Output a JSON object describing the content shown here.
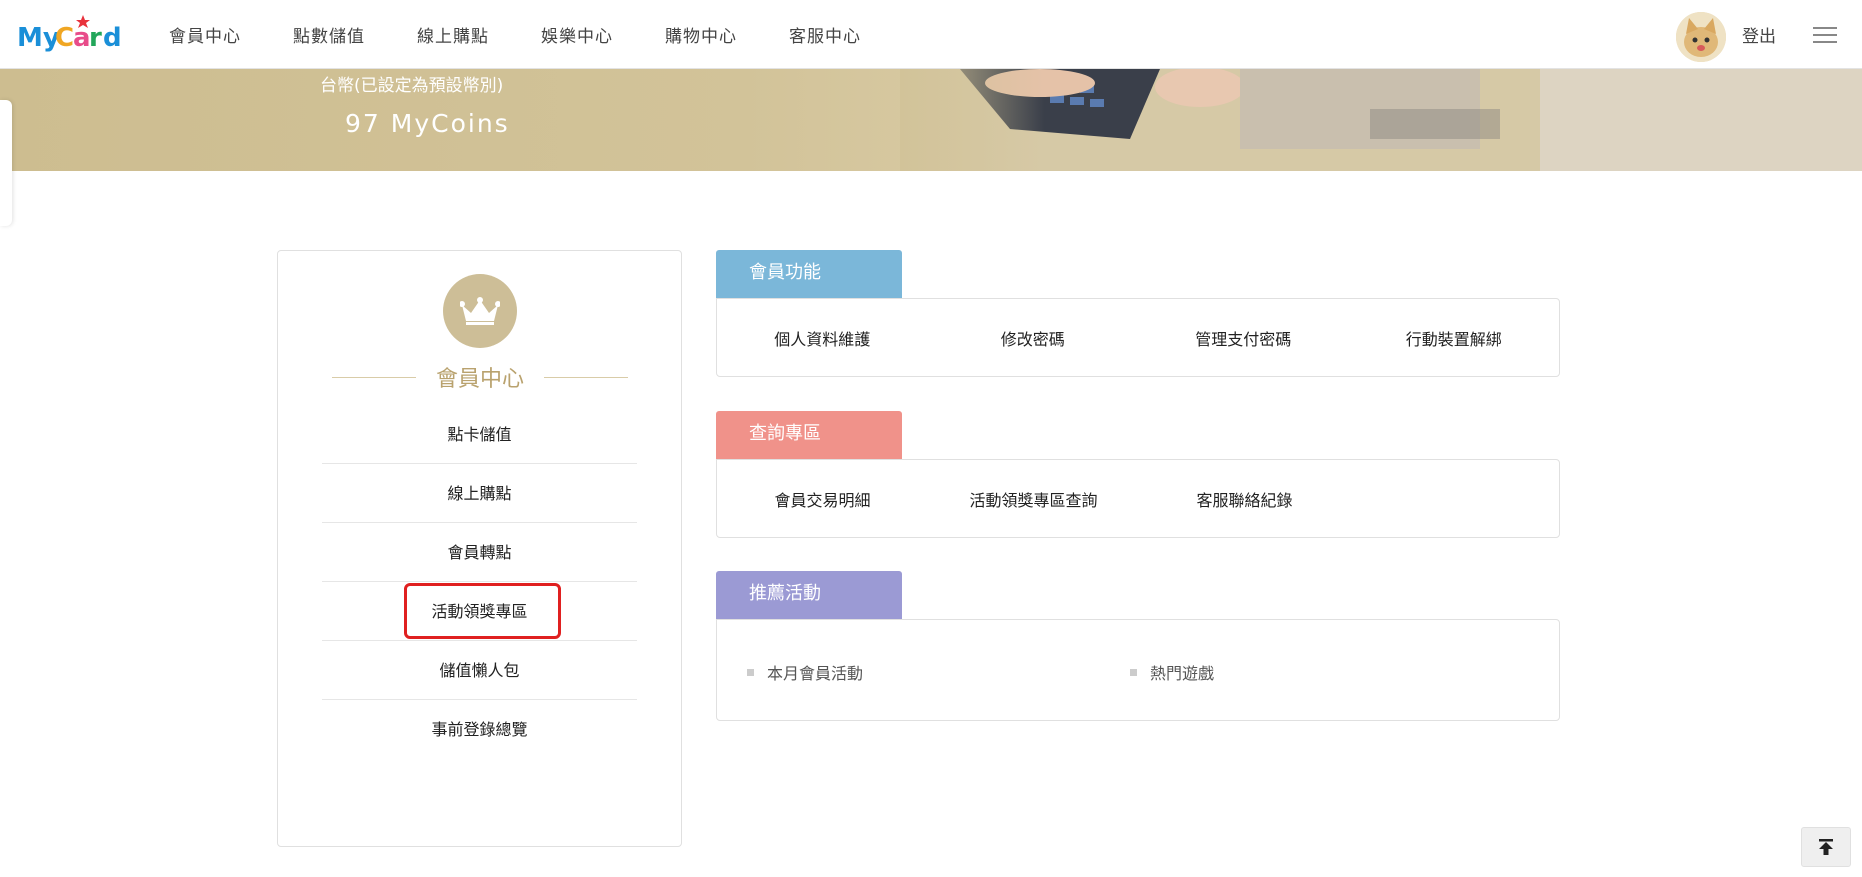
{
  "header": {
    "logo_text": "MyCard",
    "nav": [
      "會員中心",
      "點數儲值",
      "線上購點",
      "娛樂中心",
      "購物中心",
      "客服中心"
    ],
    "logout_label": "登出"
  },
  "banner": {
    "currency_label": "台幣(已設定為預設幣別)",
    "coin_amount": "97 MyCoins"
  },
  "member_panel": {
    "title": "會員中心",
    "menu": [
      "點卡儲值",
      "線上購點",
      "會員轉點",
      "活動領獎專區",
      "儲值懶人包",
      "事前登錄總覽"
    ],
    "highlighted_item": "活動領獎專區"
  },
  "sections": {
    "member_functions": {
      "title": "會員功能",
      "color": "#7bb7d9",
      "links": [
        "個人資料維護",
        "修改密碼",
        "管理支付密碼",
        "行動裝置解綁"
      ]
    },
    "query": {
      "title": "查詢專區",
      "color": "#f0928a",
      "links": [
        "會員交易明細",
        "活動領獎專區查詢",
        "客服聯絡紀錄"
      ]
    },
    "promotions": {
      "title": "推薦活動",
      "color": "#9b9ad4",
      "items": [
        "本月會員活動",
        "熱門遊戲"
      ]
    }
  }
}
